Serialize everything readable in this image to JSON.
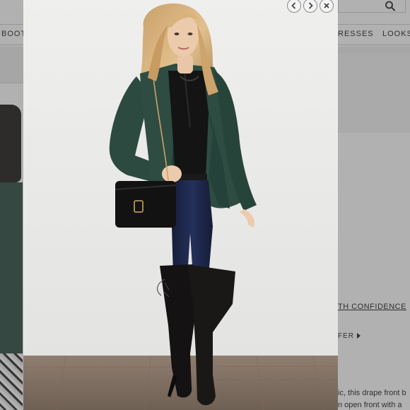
{
  "background_page": {
    "nav": {
      "left_item": "BOOT",
      "right_items": [
        "RESSES",
        "LOOKS"
      ]
    },
    "promo_link": "TH CONFIDENCE",
    "offer_text": "FER",
    "description": {
      "line1": "ic, this drape front b",
      "line2": "n open front with a"
    }
  },
  "lightbox": {
    "controls": {
      "prev_icon": "chevron-left-icon",
      "next_icon": "chevron-right-icon",
      "close_icon": "close-icon"
    }
  },
  "colors": {
    "jacket": "#2c4a40",
    "backdrop": "#ececea",
    "floor": "#8c7b6c",
    "jeans": "#1c2748"
  }
}
